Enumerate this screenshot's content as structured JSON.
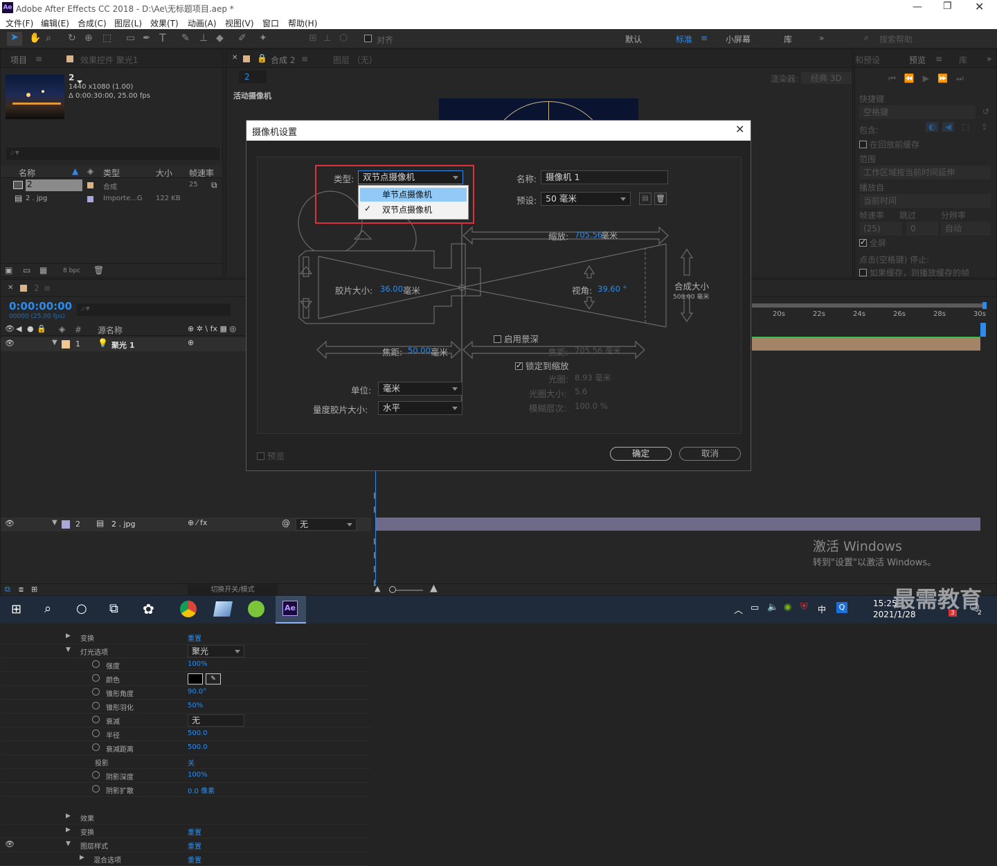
{
  "titlebar": {
    "app_icon": "Ae",
    "title": "Adobe After Effects CC 2018 - D:\\Ae\\无标题项目.aep *"
  },
  "menu": [
    "文件(F)",
    "编辑(E)",
    "合成(C)",
    "图层(L)",
    "效果(T)",
    "动画(A)",
    "视图(V)",
    "窗口",
    "帮助(H)"
  ],
  "toolbar": {
    "align_label": "对齐",
    "workspaces": [
      "默认",
      "标准",
      "小屏幕",
      "库"
    ],
    "active_workspace": "标准",
    "search_placeholder": "搜索帮助"
  },
  "project_panel": {
    "tab": "项目",
    "tab2": "效果控件 聚光1",
    "comp_name": "2",
    "comp_size": "1440 x1080 (1.00)",
    "comp_duration": "Δ 0:00:30:00, 25.00 fps",
    "columns": [
      "名称",
      "类型",
      "大小",
      "帧速率"
    ],
    "items": [
      {
        "name": "2",
        "type": "合成",
        "size": "",
        "fps": "25"
      },
      {
        "name": "2 . jpg",
        "type": "Importe...G",
        "size": "122 KB",
        "fps": ""
      }
    ],
    "bpc": "8 bpc"
  },
  "comp_viewer": {
    "tab": "合成 2",
    "tab_layer": "图层 （无）",
    "breadcrumb": "2",
    "renderer_label": "渲染器:",
    "renderer": "经典 3D",
    "active_camera": "活动摄像机"
  },
  "right_panel": {
    "tab1": "和预设",
    "tab2": "预览",
    "tab3": "库",
    "shortcut_label": "快捷键",
    "shortcut_value": "空格键",
    "include_label": "包含:",
    "cache_before": "在回放前缓存",
    "range_label": "范围",
    "range_value": "工作区域按当前时间延伸",
    "play_from_label": "播放自",
    "play_from_value": "当前时间",
    "fps_label": "帧速率",
    "skip_label": "跳过",
    "res_label": "分辨率",
    "fps_value": "(25)",
    "skip_value": "0",
    "res_value": "自动",
    "fullscreen": "全屏",
    "stop_label": "点击(空格键) 停止:",
    "if_cached": "如果缓存，则播放缓存的帧"
  },
  "timeline": {
    "tab": "2",
    "timecode": "0:00:00:00",
    "timecode_sub": "00000 (25.00 fps)",
    "col_source": "源名称",
    "col_num": "#",
    "ruler": [
      "20s",
      "22s",
      "24s",
      "26s",
      "28s",
      "30s"
    ],
    "layers": [
      {
        "id": "1",
        "name": "聚光 1"
      },
      {
        "id": "2",
        "name": "2 . jpg",
        "parent": "无"
      }
    ],
    "props": [
      {
        "label": "变换",
        "value": "重置",
        "depth": 1
      },
      {
        "label": "灯光选项",
        "value": "聚光",
        "depth": 1
      },
      {
        "label": "强度",
        "value": "100%",
        "depth": 2
      },
      {
        "label": "颜色",
        "value": "",
        "depth": 2
      },
      {
        "label": "锥形角度",
        "value": "90.0°",
        "depth": 2
      },
      {
        "label": "锥形羽化",
        "value": "50%",
        "depth": 2
      },
      {
        "label": "衰减",
        "value": "无",
        "depth": 2
      },
      {
        "label": "半径",
        "value": "500.0",
        "depth": 2
      },
      {
        "label": "衰减距离",
        "value": "500.0",
        "depth": 2
      },
      {
        "label": "投影",
        "value": "关",
        "depth": 2
      },
      {
        "label": "阴影深度",
        "value": "100%",
        "depth": 2
      },
      {
        "label": "阴影扩散",
        "value": "0.0 像素",
        "depth": 2
      }
    ],
    "props2": [
      {
        "label": "效果",
        "value": ""
      },
      {
        "label": "变换",
        "value": "重置"
      },
      {
        "label": "图层样式",
        "value": "重置"
      },
      {
        "label": "混合选项",
        "value": "重置"
      }
    ],
    "toggle_label": "切换开关/模式"
  },
  "dialog": {
    "title": "摄像机设置",
    "type_label": "类型:",
    "type_value": "双节点摄像机",
    "type_options": [
      "单节点摄像机",
      "双节点摄像机"
    ],
    "type_selected": "双节点摄像机",
    "name_label": "名称:",
    "name_value": "摄像机 1",
    "preset_label": "预设:",
    "preset_value": "50 毫米",
    "zoom_label": "缩放:",
    "zoom_value": "705.56",
    "zoom_unit": "毫米",
    "film_label": "胶片大小:",
    "film_value": "36.00",
    "film_unit": "毫米",
    "angle_label": "视角:",
    "angle_value": "39.60 °",
    "comp_size_label": "合成大小",
    "comp_size_value": "508.00 毫米",
    "dof_label": "启用景深",
    "focal_label": "焦距:",
    "focal_value": "50.00",
    "focal_unit": "毫米",
    "focus_dist_label": "焦距:",
    "focus_dist_value": "705.56 毫米",
    "lock_label": "锁定到缩放",
    "aperture_label": "光圈:",
    "aperture_value": "8.93 毫米",
    "fstop_label": "光圈大小:",
    "fstop_value": "5.6",
    "blur_label": "模糊层次:",
    "blur_value": "100.0 %",
    "units_label": "单位:",
    "units_value": "毫米",
    "measure_label": "量度胶片大小:",
    "measure_value": "水平",
    "preview_label": "预览",
    "ok": "确定",
    "cancel": "取消",
    "highlight_color": "#e0303a"
  },
  "watermark": {
    "line1": "激活 Windows",
    "line2": "转到\"设置\"以激活 Windows。"
  },
  "brand": "最需教育",
  "taskbar": {
    "time": "15:25",
    "date": "2021/1/28",
    "ime": "中",
    "badge": "3",
    "notif": "2"
  }
}
